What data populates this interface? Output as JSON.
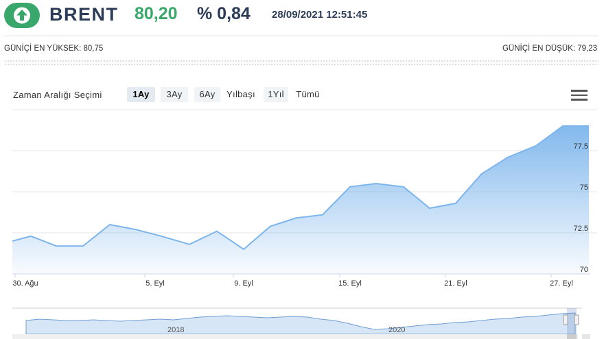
{
  "header": {
    "name": "BRENT",
    "price": "80,20",
    "change": "% 0,84",
    "datetime": "28/09/2021 12:51:45",
    "direction_icon": "arrow-up-icon",
    "up_color": "#39a76b",
    "name_color": "#2c3b57"
  },
  "day_stats": {
    "high_label": "GÜNİÇİ EN YÜKSEK: 80,75",
    "low_label": "GÜNİÇİ EN DÜŞÜK: 79,23"
  },
  "range_selector": {
    "label": "Zaman Aralığı Seçimi",
    "buttons": [
      "1Ay",
      "3Ay",
      "6Ay",
      "Yılbaşı",
      "1Yıl",
      "Tümü"
    ],
    "selected": "1Ay",
    "menu_icon": "hamburger-menu-icon"
  },
  "chart_data": {
    "type": "area",
    "x": [
      "30. Ağu",
      "31. Ağu",
      "1. Eyl",
      "2. Eyl",
      "3. Eyl",
      "4. Eyl",
      "5. Eyl",
      "6. Eyl",
      "7. Eyl",
      "8. Eyl",
      "9. Eyl",
      "10. Eyl",
      "11. Eyl",
      "12. Eyl",
      "13. Eyl",
      "14. Eyl",
      "15. Eyl",
      "16. Eyl",
      "17. Eyl",
      "18. Eyl",
      "19. Eyl",
      "20. Eyl",
      "21. Eyl",
      "22. Eyl",
      "23. Eyl",
      "24. Eyl",
      "25. Eyl",
      "26. Eyl",
      "27. Eyl",
      "28. Eyl"
    ],
    "values": [
      72.0,
      72.3,
      71.7,
      71.7,
      73.0,
      72.7,
      72.3,
      71.8,
      72.6,
      71.5,
      72.9,
      73.4,
      73.6,
      75.3,
      75.5,
      75.3,
      74.0,
      74.3,
      76.1,
      77.1,
      77.8,
      79.0,
      79.0
    ],
    "x_tick_labels": [
      "30. Ağu",
      "5. Eyl",
      "9. Eyl",
      "15. Eyl",
      "21. Eyl",
      "27. Eyl"
    ],
    "y_ticks": [
      "70",
      "72.5",
      "75",
      "77.5"
    ],
    "ylim": [
      70,
      80
    ],
    "grid": true,
    "line_color": "#7cb5ec"
  },
  "navigator": {
    "labels": [
      "2018",
      "2020"
    ]
  }
}
